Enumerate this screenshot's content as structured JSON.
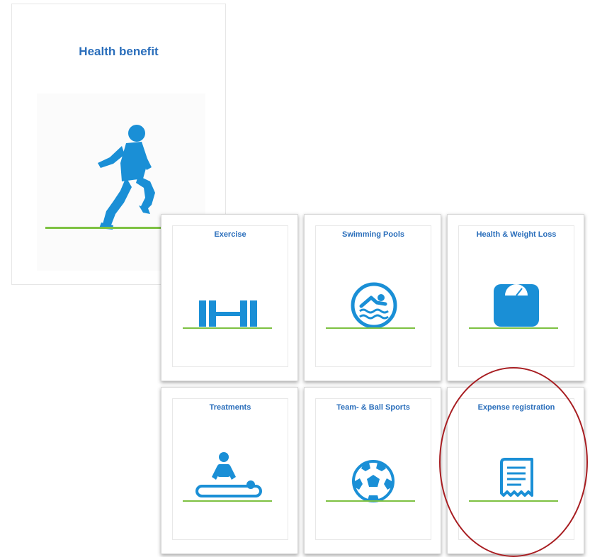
{
  "main_card": {
    "title": "Health benefit",
    "icon": "runner-icon"
  },
  "tiles": [
    {
      "label": "Exercise",
      "icon": "dumbbell-icon"
    },
    {
      "label": "Swimming Pools",
      "icon": "swimmer-icon"
    },
    {
      "label": "Health & Weight Loss",
      "icon": "scale-icon"
    },
    {
      "label": "Treatments",
      "icon": "massage-icon"
    },
    {
      "label": "Team- & Ball Sports",
      "icon": "soccer-ball-icon"
    },
    {
      "label": "Expense registration",
      "icon": "receipt-icon"
    }
  ],
  "colors": {
    "accent": "#1a8fd6",
    "title": "#2a6ebb",
    "ground": "#7dc142",
    "highlight": "#a81e22"
  }
}
